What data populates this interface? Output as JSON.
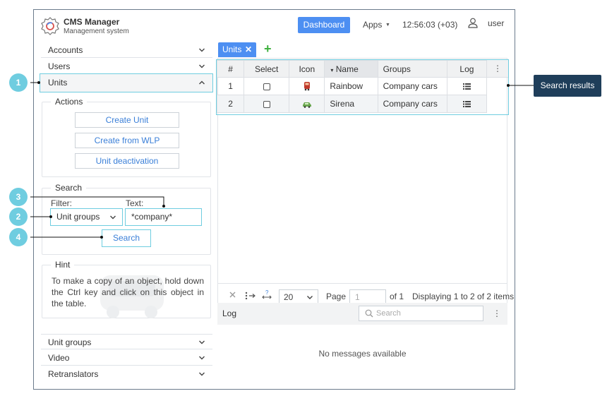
{
  "header": {
    "app_name": "CMS Manager",
    "app_subtitle": "Management system",
    "dashboard_label": "Dashboard",
    "apps_label": "Apps",
    "clock": "12:56:03 (+03)",
    "user_label": "user"
  },
  "sidebar": {
    "accordion_top": [
      {
        "label": "Accounts",
        "expanded": false
      },
      {
        "label": "Users",
        "expanded": false
      },
      {
        "label": "Units",
        "expanded": true
      }
    ],
    "actions": {
      "legend": "Actions",
      "buttons": [
        "Create Unit",
        "Create from WLP",
        "Unit deactivation"
      ]
    },
    "search": {
      "legend": "Search",
      "filter_label": "Filter:",
      "filter_value": "Unit groups",
      "text_label": "Text:",
      "text_value": "*company*",
      "search_button": "Search"
    },
    "hint": {
      "legend": "Hint",
      "text": "To make a copy of an object, hold down the Ctrl key and click on this object in the table."
    },
    "accordion_bottom": [
      {
        "label": "Unit groups"
      },
      {
        "label": "Video"
      },
      {
        "label": "Retranslators"
      }
    ]
  },
  "tabs": {
    "active_tab": "Units",
    "close_glyph": "✕",
    "add_glyph": "+"
  },
  "table": {
    "columns": [
      "#",
      "Select",
      "Icon",
      "Name",
      "Groups",
      "Log"
    ],
    "sort_indicator": "▾",
    "more_glyph": "⋮",
    "rows": [
      {
        "num": "1",
        "name": "Rainbow",
        "groups": "Company cars",
        "icon": "bus-icon",
        "icon_color": "#c0392b"
      },
      {
        "num": "2",
        "name": "Sirena",
        "groups": "Company cars",
        "icon": "car-icon",
        "icon_color": "#6aa84f"
      }
    ]
  },
  "pager": {
    "page_size": "20",
    "page_label": "Page",
    "page_value": "1",
    "of_label": "of 1",
    "display_text": "Displaying 1 to 2 of 2 items"
  },
  "log": {
    "title": "Log",
    "search_placeholder": "Search",
    "empty_text": "No messages available"
  },
  "annotations": {
    "badges": [
      "1",
      "2",
      "3",
      "4"
    ],
    "callout": "Search results"
  },
  "colors": {
    "accent": "#4d8ff2",
    "highlight": "#6fcde0",
    "callout_bg": "#1f3e5a",
    "add_green": "#3fb13f"
  }
}
